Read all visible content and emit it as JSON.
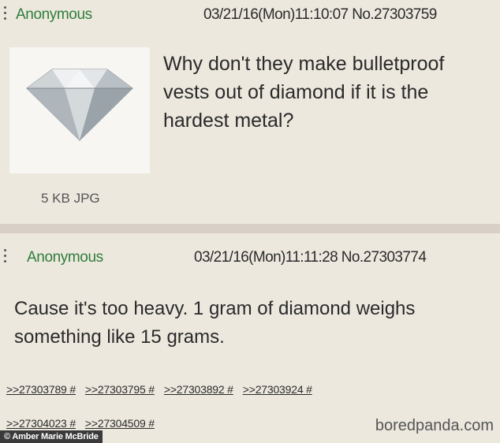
{
  "posts": [
    {
      "name": "Anonymous",
      "meta": "03/21/16(Mon)11:10:07 No.27303759",
      "file_info": "5 KB JPG",
      "image_icon": "diamond-image",
      "body": "Why don't they make bulletproof vests out of diamond if it is the hardest metal?"
    },
    {
      "name": "Anonymous",
      "meta": "03/21/16(Mon)11:11:28 No.27303774",
      "body": "Cause it's too heavy. 1 gram of diamond weighs something like 15 grams.",
      "replies_row1": [
        ">>27303789 #",
        ">>27303795 #",
        ">>27303892 #",
        ">>27303924 #"
      ],
      "replies_row2": [
        ">>27304023 #",
        ">>27304509 #"
      ]
    }
  ],
  "credit": "© Amber Marie McBride",
  "watermark": "boredpanda.com",
  "colors": {
    "name": "#2f7d3a",
    "post_bg": "#ece8de",
    "page_bg": "#d8d0c6"
  }
}
